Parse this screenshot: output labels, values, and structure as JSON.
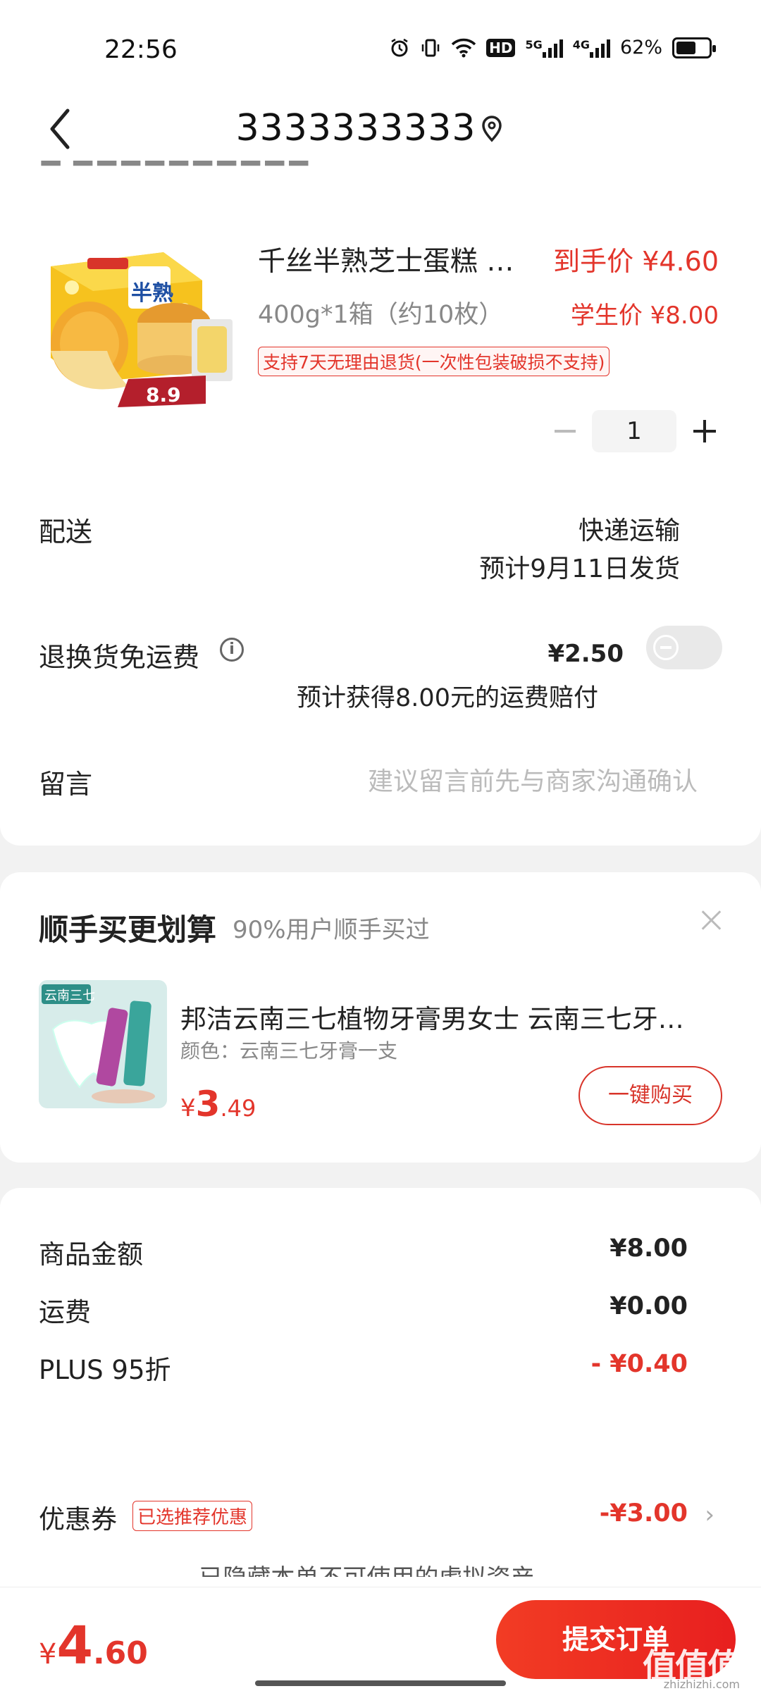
{
  "status_bar": {
    "time": "22:56",
    "battery_text": "62%",
    "battery_level": 0.62,
    "network": "5G",
    "network2": "4G",
    "hd": "HD"
  },
  "header": {
    "title": "3333333333"
  },
  "product": {
    "name": "千丝半熟芝士蛋糕 …",
    "price_label": "到手价 ¥4.60",
    "spec": "400g*1箱（约10枚）",
    "student_price": "学生价 ¥8.00",
    "return_tag": "支持7天无理由退货(一次性包装破损不支持)",
    "image_price": "8.9",
    "quantity": "1"
  },
  "delivery": {
    "label": "配送",
    "method": "快递运输",
    "eta": "预计9月11日发货"
  },
  "return_shipping": {
    "label": "退换货免运费",
    "price": "¥2.50",
    "compensation": "预计获得8.00元的运费赔付",
    "enabled": false
  },
  "note": {
    "label": "留言",
    "placeholder": "建议留言前先与商家沟通确认"
  },
  "recommend": {
    "title": "顺手买更划算",
    "subtitle": "90%用户顺手买过",
    "item_name": "邦洁云南三七植物牙膏男女士 云南三七牙…",
    "variant": "颜色：云南三七牙膏一支",
    "price_currency": "¥",
    "price_int": "3",
    "price_dec": ".49",
    "buy_label": "一键购买",
    "image_text": "云南三七"
  },
  "summary": {
    "goods_label": "商品金额",
    "goods_value": "¥8.00",
    "shipping_label": "运费",
    "shipping_value": "¥0.00",
    "plus_label": "PLUS 95折",
    "plus_value": "- ¥0.40",
    "coupon_label": "优惠券",
    "coupon_tag": "已选推荐优惠",
    "coupon_value": "-¥3.00",
    "hidden_assets": "已隐藏本单不可使用的虚拟资产"
  },
  "bottom": {
    "total_currency": "¥",
    "total_int": "4",
    "total_dec": ".60",
    "submit_label": "提交订单",
    "watermark": "值值值",
    "watermark_url": "zhizhizhi.com"
  },
  "colors": {
    "accent": "#e3352b",
    "submit": "#f23c24"
  }
}
